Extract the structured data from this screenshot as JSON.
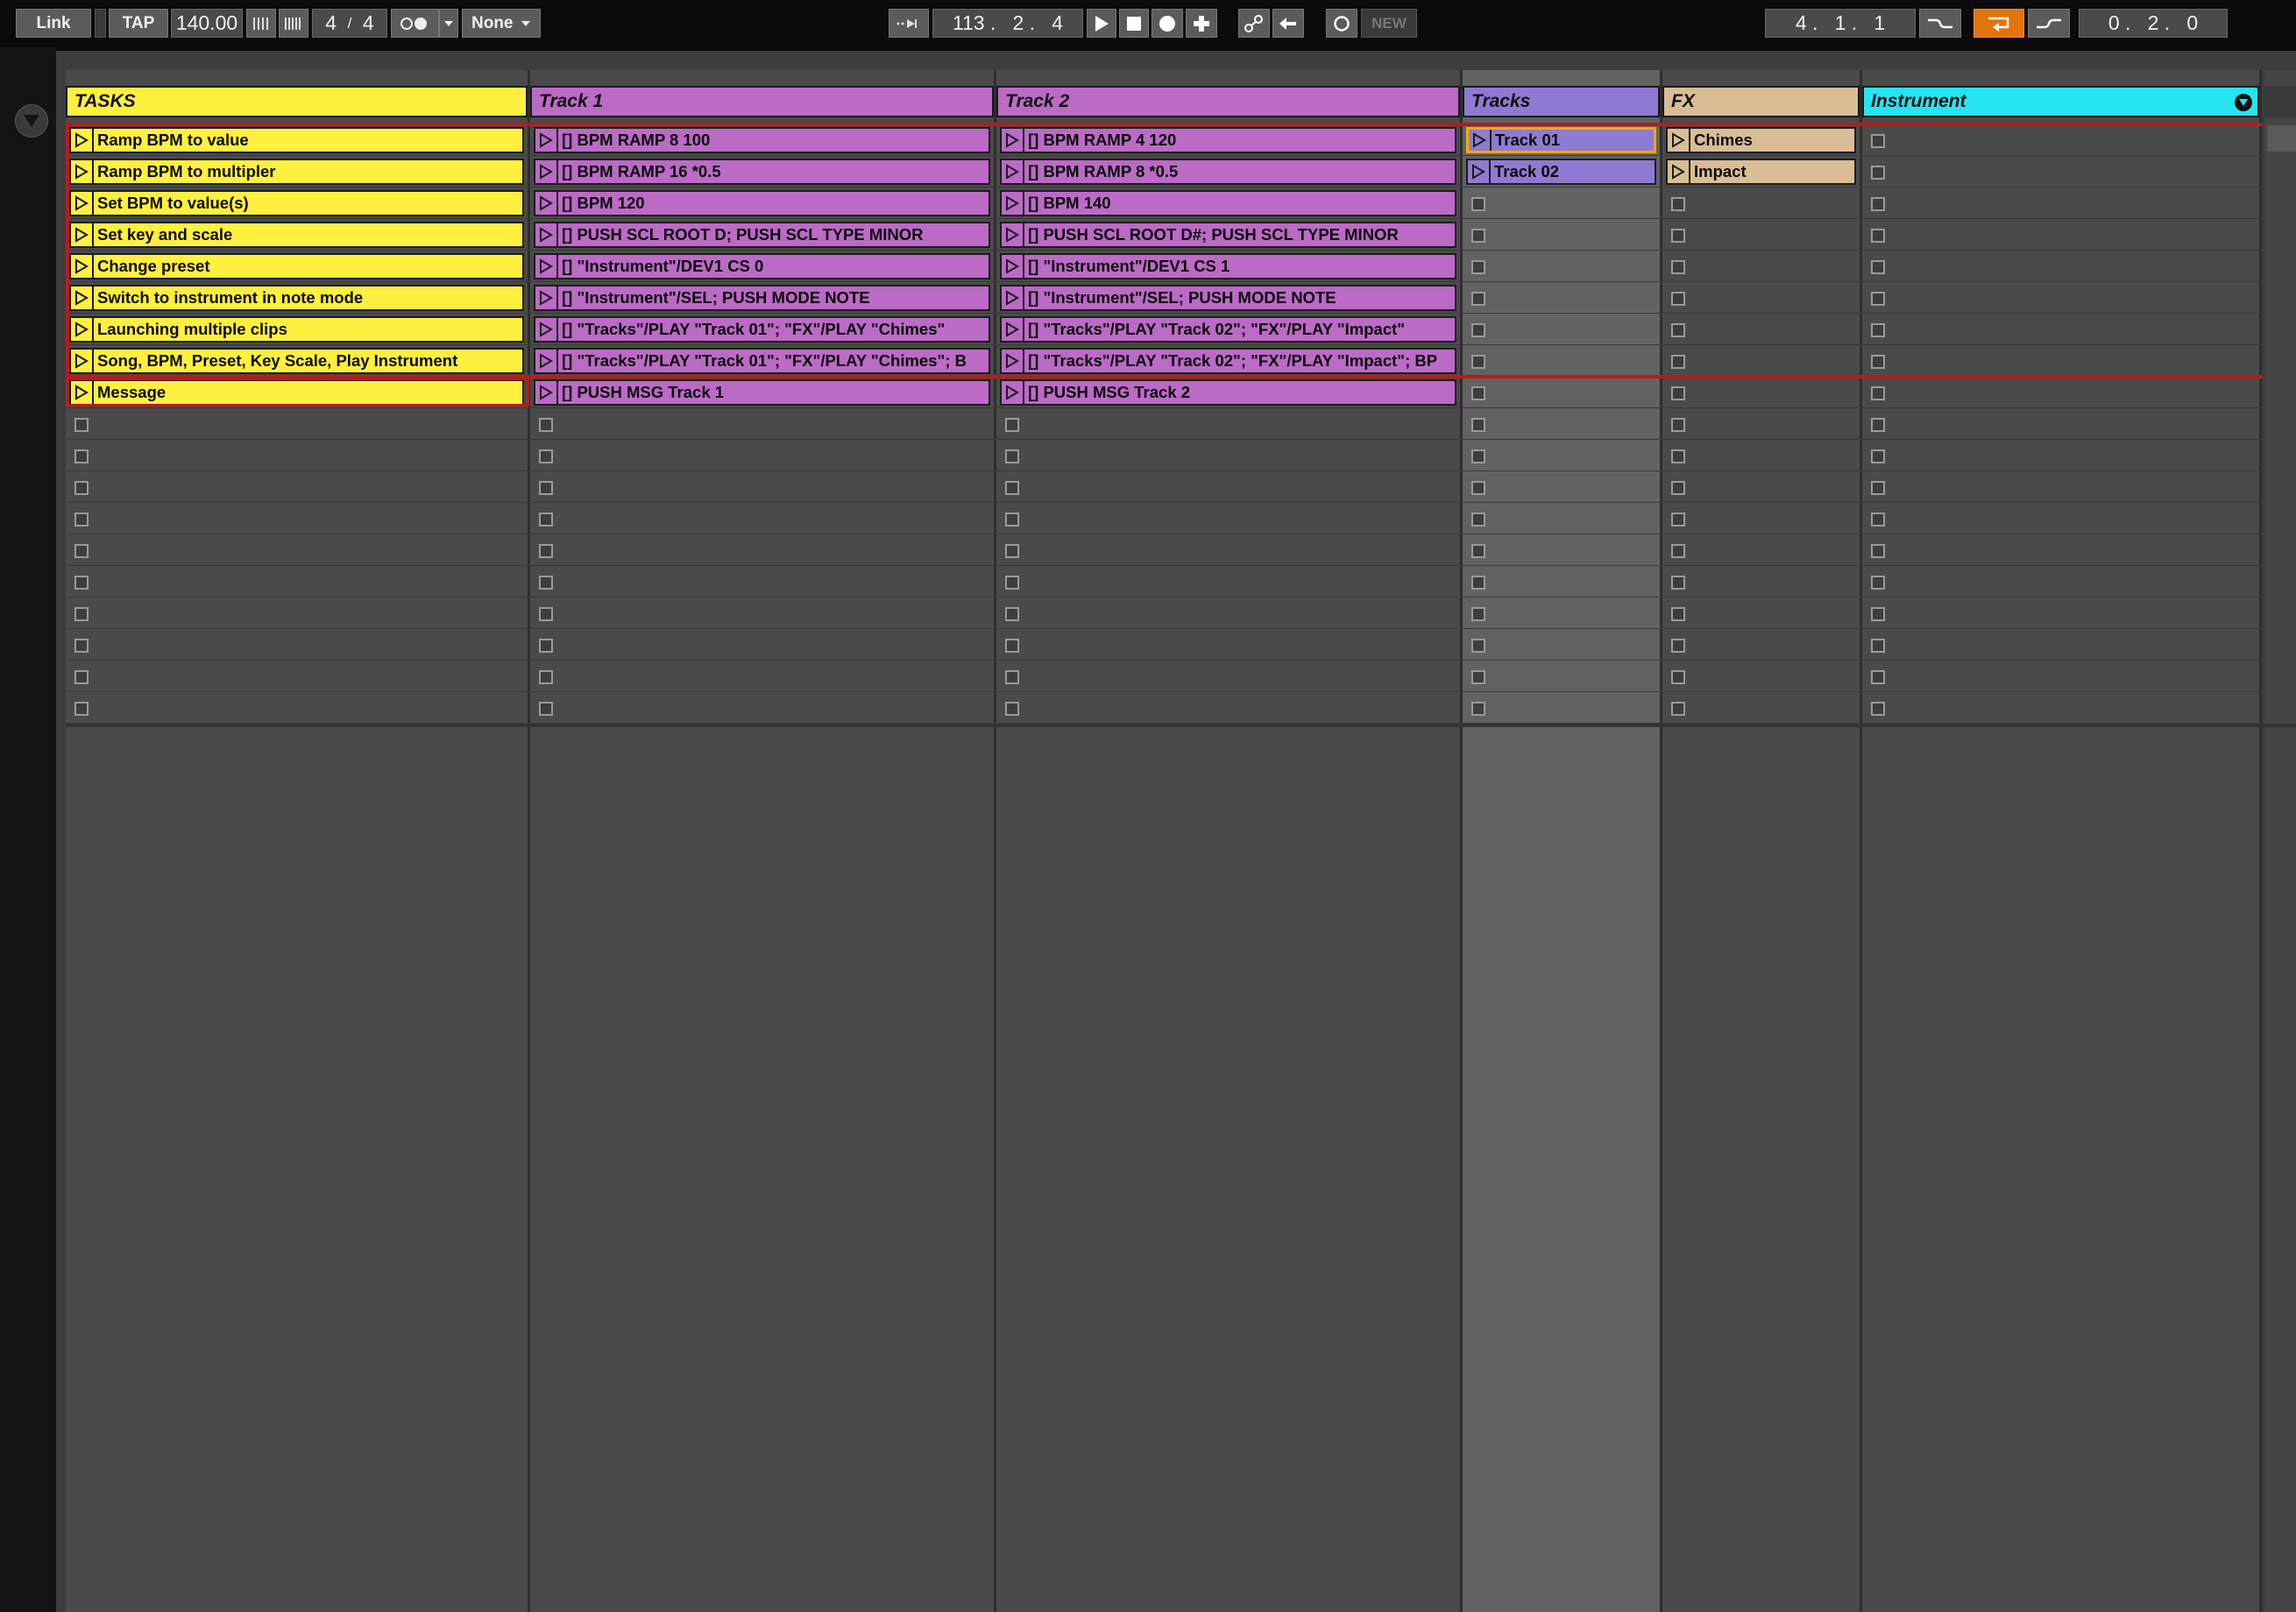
{
  "transport": {
    "link": "Link",
    "tap": "TAP",
    "tempo": "140.00",
    "sig_num": "4",
    "sig_sep": "/",
    "sig_den": "4",
    "quantize": "None",
    "position": "113 .   2 .   4",
    "new": "NEW",
    "loop_start": "4 .   1 .   1",
    "loop_length": "0 .   2 .   0"
  },
  "columns": [
    {
      "name": "TASKS",
      "color": "#ffef3f"
    },
    {
      "name": "Track 1",
      "color": "#bb6ac6"
    },
    {
      "name": "Track 2",
      "color": "#bb6ac6"
    },
    {
      "name": "Tracks",
      "color": "#8f7ad3"
    },
    {
      "name": "FX",
      "color": "#d9bd94"
    },
    {
      "name": "Instrument",
      "color": "#26e5f2"
    }
  ],
  "tasks": [
    "Ramp BPM to value",
    "Ramp BPM to multipler",
    "Set BPM to value(s)",
    "Set key and scale",
    "Change preset",
    "Switch to instrument in note mode",
    "Launching multiple clips",
    "Song, BPM, Preset, Key Scale, Play Instrument",
    "Message"
  ],
  "track1": [
    "[] BPM RAMP 8 100",
    "[] BPM RAMP 16 *0.5",
    "[] BPM 120",
    "[] PUSH SCL ROOT D; PUSH SCL TYPE MINOR",
    "[] \"Instrument\"/DEV1 CS 0",
    "[] \"Instrument\"/SEL; PUSH MODE NOTE",
    "[] \"Tracks\"/PLAY \"Track 01\"; \"FX\"/PLAY \"Chimes\"",
    "[] \"Tracks\"/PLAY \"Track 01\"; \"FX\"/PLAY \"Chimes\"; B",
    "[] PUSH MSG Track 1"
  ],
  "track2": [
    "[] BPM RAMP 4 120",
    "[] BPM RAMP 8 *0.5",
    "[] BPM 140",
    "[] PUSH SCL ROOT D#; PUSH SCL TYPE MINOR",
    "[] \"Instrument\"/DEV1 CS 1",
    "[] \"Instrument\"/SEL; PUSH MODE NOTE",
    "[] \"Tracks\"/PLAY \"Track 02\"; \"FX\"/PLAY \"Impact\"",
    "[] \"Tracks\"/PLAY \"Track 02\"; \"FX\"/PLAY \"Impact\"; BP",
    "[] PUSH MSG Track 2"
  ],
  "tracks_col": [
    "Track 01",
    "Track 02"
  ],
  "fx_col": [
    "Chimes",
    "Impact"
  ]
}
